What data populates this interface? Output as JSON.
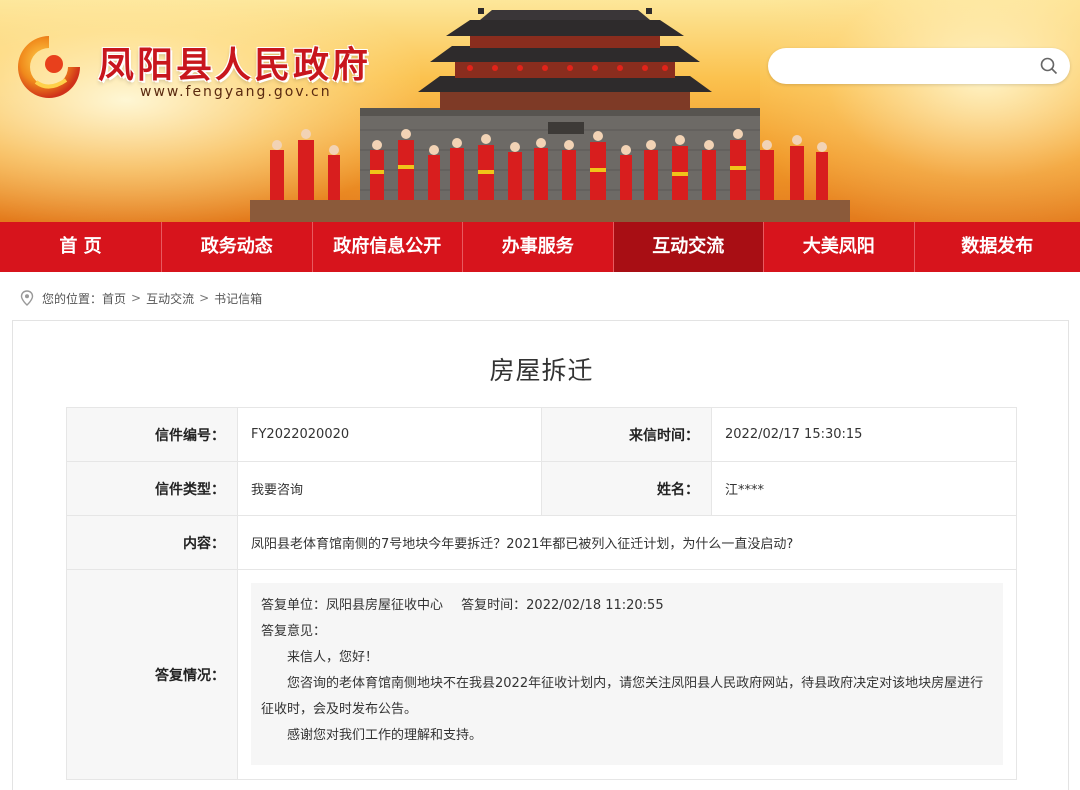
{
  "site": {
    "title": "凤阳县人民政府",
    "url": "www.fengyang.gov.cn",
    "search_placeholder": ""
  },
  "nav": {
    "items": [
      {
        "label": "首 页",
        "active": false
      },
      {
        "label": "政务动态",
        "active": false
      },
      {
        "label": "政府信息公开",
        "active": false
      },
      {
        "label": "办事服务",
        "active": false
      },
      {
        "label": "互动交流",
        "active": true
      },
      {
        "label": "大美凤阳",
        "active": false
      },
      {
        "label": "数据发布",
        "active": false
      }
    ]
  },
  "breadcrumb": {
    "prefix": "您的位置：",
    "items": [
      "首页",
      "互动交流",
      "书记信箱"
    ],
    "separator": ">"
  },
  "letter": {
    "title": "房屋拆迁",
    "number_label": "信件编号：",
    "number_value": "FY2022020020",
    "time_label": "来信时间：",
    "time_value": "2022/02/17 15:30:15",
    "type_label": "信件类型：",
    "type_value": "我要咨询",
    "name_label": "姓名：",
    "name_value": "江****",
    "content_label": "内容：",
    "content_value": "凤阳县老体育馆南侧的7号地块今年要拆迁？2021年都已被列入征迁计划，为什么一直没启动?",
    "reply_label": "答复情况："
  },
  "reply": {
    "unit": "答复单位：凤阳县房屋征收中心",
    "time": "答复时间：2022/02/18 11:20:55",
    "opinion_label": "答复意见：",
    "greeting": "来信人，您好！",
    "body": "您咨询的老体育馆南侧地块不在我县2022年征收计划内，请您关注凤阳县人民政府网站，待县政府决定对该地块房屋进行征收时，会及时发布公告。",
    "thanks": "感谢您对我们工作的理解和支持。"
  },
  "colors": {
    "brand_red": "#d7141c",
    "nav_active": "#a80e14",
    "title_red": "#c8161d"
  }
}
